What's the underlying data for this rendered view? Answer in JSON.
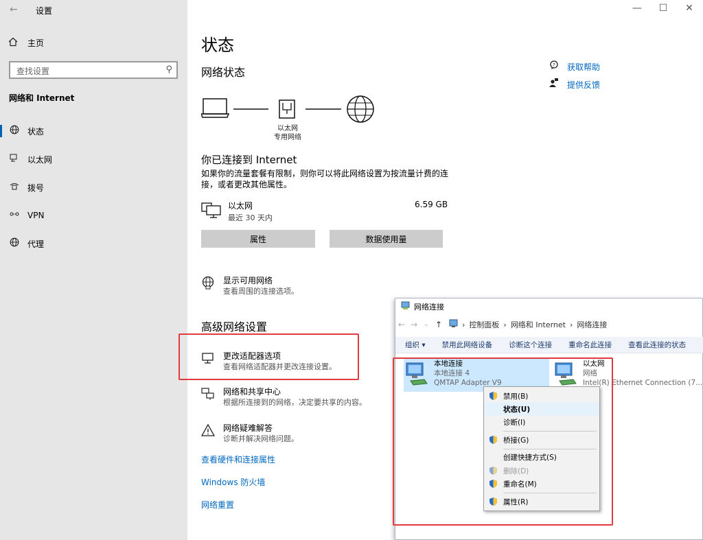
{
  "sidebar": {
    "app_title": "设置",
    "home_label": "主页",
    "search_placeholder": "查找设置",
    "section_label": "网络和 Internet",
    "items": [
      {
        "label": "状态",
        "icon": "globe-icon"
      },
      {
        "label": "以太网",
        "icon": "ethernet-icon"
      },
      {
        "label": "拨号",
        "icon": "dialup-icon"
      },
      {
        "label": "VPN",
        "icon": "vpn-icon"
      },
      {
        "label": "代理",
        "icon": "proxy-globe-icon"
      }
    ]
  },
  "main": {
    "page_title": "状态",
    "network_status_heading": "网络状态",
    "diagram_label_1": "以太网",
    "diagram_label_2": "专用网络",
    "connected_heading": "你已连接到 Internet",
    "connected_desc": "如果你的流量套餐有限制，则你可以将此网络设置为按流量计费的连接，或者更改其他属性。",
    "ethernet": {
      "name": "以太网",
      "period": "最近 30 天内",
      "usage": "6.59 GB"
    },
    "buttons": {
      "properties": "属性",
      "data_usage": "数据使用量"
    },
    "show_networks": {
      "title": "显示可用网络",
      "desc": "查看周围的连接选项。"
    },
    "advanced_heading": "高级网络设置",
    "change_adapter": {
      "title": "更改适配器选项",
      "desc": "查看网络适配器并更改连接设置。"
    },
    "sharing_center": {
      "title": "网络和共享中心",
      "desc": "根据所连接到的网络，决定要共享的内容。"
    },
    "troubleshoot": {
      "title": "网络疑难解答",
      "desc": "诊断并解决网络问题。"
    },
    "links": {
      "hardware": "查看硬件和连接属性",
      "firewall": "Windows 防火墙",
      "reset": "网络重置"
    },
    "help": {
      "get_help": "获取帮助",
      "feedback": "提供反馈"
    }
  },
  "nc_window": {
    "title": "网络连接",
    "breadcrumb": [
      "控制面板",
      "网络和 Internet",
      "网络连接"
    ],
    "toolbar": [
      "组织 ▾",
      "禁用此网络设备",
      "诊断这个连接",
      "重命名此连接",
      "查看此连接的状态"
    ],
    "adapters": [
      {
        "name": "本地连接",
        "line2": "本地连接 4",
        "line3": "QMTAP Adapter V9"
      },
      {
        "name": "以太网",
        "line2": "网络",
        "line3": "Intel(R) Ethernet Connection (7..."
      }
    ]
  },
  "context_menu": {
    "items": [
      "禁用(B)",
      "状态(U)",
      "诊断(I)",
      "桥接(G)",
      "创建快捷方式(S)",
      "删除(D)",
      "重命名(M)",
      "属性(R)"
    ]
  },
  "colors": {
    "accent": "#0063b1",
    "link": "#0067c0",
    "highlight_box": "#e0393e"
  }
}
